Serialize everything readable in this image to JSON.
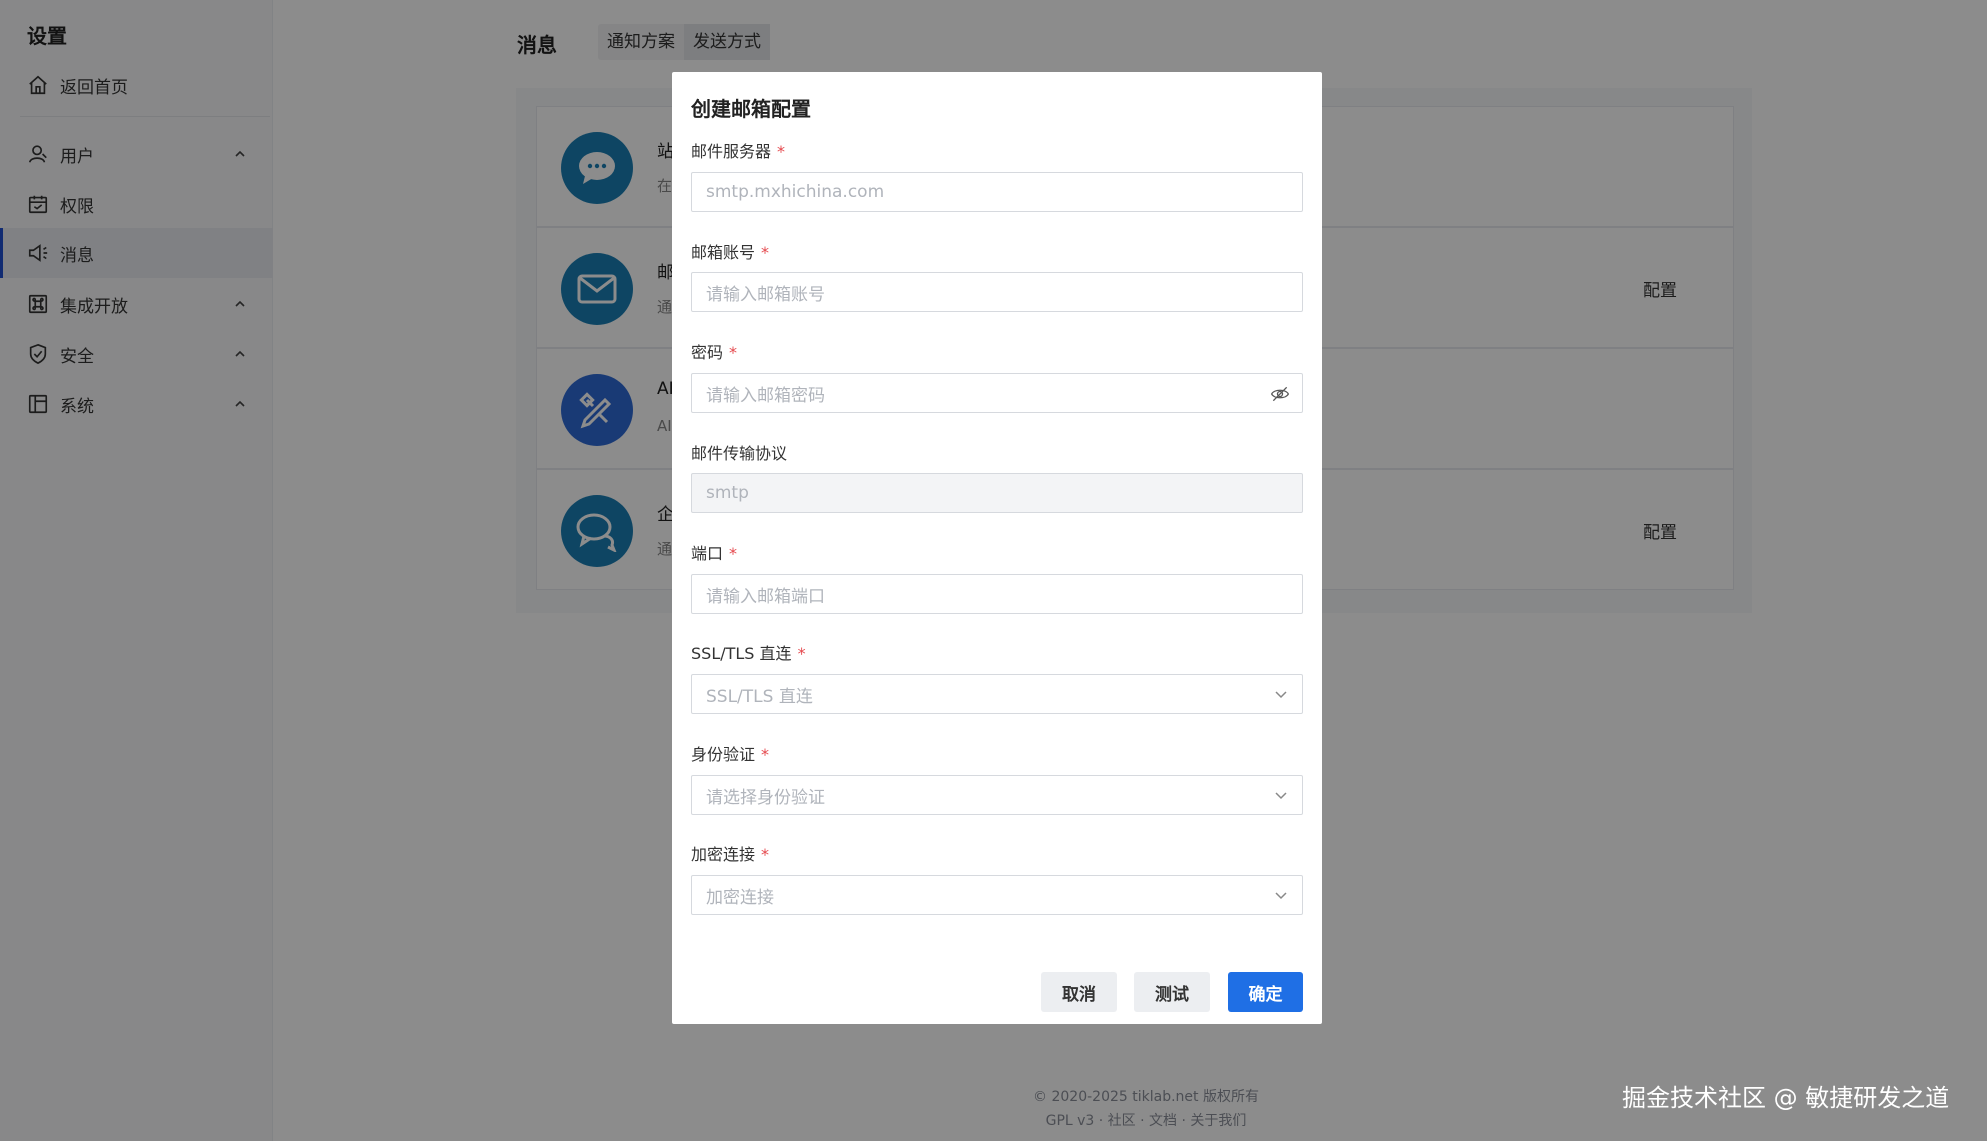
{
  "sidebar": {
    "title": "设置",
    "home": "返回首页",
    "items": [
      {
        "label": "用户",
        "icon": "user-icon",
        "expandable": true
      },
      {
        "label": "权限",
        "icon": "calendar-icon",
        "expandable": false
      },
      {
        "label": "消息",
        "icon": "megaphone-icon",
        "expandable": false,
        "active": true
      },
      {
        "label": "集成开放",
        "icon": "command-icon",
        "expandable": true
      },
      {
        "label": "安全",
        "icon": "shield-icon",
        "expandable": true
      },
      {
        "label": "系统",
        "icon": "layout-icon",
        "expandable": true
      }
    ]
  },
  "header": {
    "title": "消息",
    "tabs": [
      {
        "label": "通知方案",
        "active": false
      },
      {
        "label": "发送方式",
        "active": true
      }
    ]
  },
  "cards": [
    {
      "name": "站",
      "desc": "在",
      "icon": "chat-bubble-icon",
      "action": ""
    },
    {
      "name": "邮",
      "desc": "通",
      "icon": "mail-icon",
      "action": "配置"
    },
    {
      "name": "AI",
      "desc": "AI",
      "icon": "pen-tools-icon",
      "action": ""
    },
    {
      "name": "企",
      "desc": "通",
      "icon": "chat-bubbles-icon",
      "action": "配置"
    }
  ],
  "modal": {
    "title": "创建邮箱配置",
    "fields": [
      {
        "label": "邮件服务器",
        "required": true,
        "placeholder": "smtp.mxhichina.com",
        "type": "text"
      },
      {
        "label": "邮箱账号",
        "required": true,
        "placeholder": "请输入邮箱账号",
        "type": "text"
      },
      {
        "label": "密码",
        "required": true,
        "placeholder": "请输入邮箱密码",
        "type": "password"
      },
      {
        "label": "邮件传输协议",
        "required": false,
        "placeholder": "smtp",
        "type": "disabled"
      },
      {
        "label": "端口",
        "required": true,
        "placeholder": "请输入邮箱端口",
        "type": "text"
      },
      {
        "label": "SSL/TLS 直连",
        "required": true,
        "placeholder": "SSL/TLS 直连",
        "type": "select"
      },
      {
        "label": "身份验证",
        "required": true,
        "placeholder": "请选择身份验证",
        "type": "select"
      },
      {
        "label": "加密连接",
        "required": true,
        "placeholder": "加密连接",
        "type": "select"
      }
    ],
    "buttons": {
      "cancel": "取消",
      "test": "测试",
      "confirm": "确定"
    }
  },
  "footer": {
    "line1": "© 2020-2025 tiklab.net 版权所有",
    "line2": "GPL v3 · 社区 · 文档 · 关于我们"
  },
  "watermark": "掘金技术社区 @ 敏捷研发之道",
  "colors": {
    "primary": "#1f6fe5",
    "required": "#e5484d",
    "active_nav_border": "#1f4fd0"
  }
}
